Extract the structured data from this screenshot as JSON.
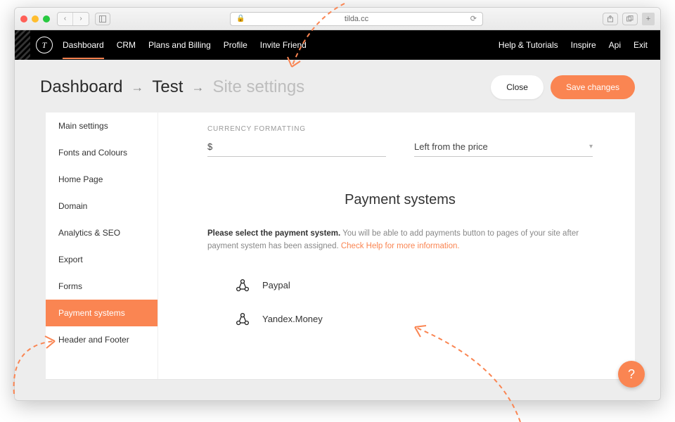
{
  "browser": {
    "url": "tilda.cc"
  },
  "topnav": {
    "left": [
      "Dashboard",
      "CRM",
      "Plans and Billing",
      "Profile",
      "Invite Friend"
    ],
    "right": [
      "Help & Tutorials",
      "Inspire",
      "Api",
      "Exit"
    ],
    "active_index": 0,
    "logo_letter": "T"
  },
  "breadcrumbs": {
    "a": "Dashboard",
    "b": "Test",
    "c": "Site settings"
  },
  "buttons": {
    "close": "Close",
    "save": "Save changes"
  },
  "sidebar": {
    "items": [
      "Main settings",
      "Fonts and Colours",
      "Home Page",
      "Domain",
      "Analytics & SEO",
      "Export",
      "Forms",
      "Payment systems",
      "Header and Footer"
    ],
    "active_index": 7
  },
  "currency": {
    "label": "CURRENCY FORMATTING",
    "symbol": "$",
    "position": "Left from the price"
  },
  "payment": {
    "title": "Payment systems",
    "desc_bold": "Please select the payment system.",
    "desc_rest": " You will be able to add payments button to pages of your site after payment system has been assigned. ",
    "desc_link": "Check Help for more information.",
    "options": [
      "Paypal",
      "Yandex.Money"
    ]
  },
  "help_glyph": "?"
}
